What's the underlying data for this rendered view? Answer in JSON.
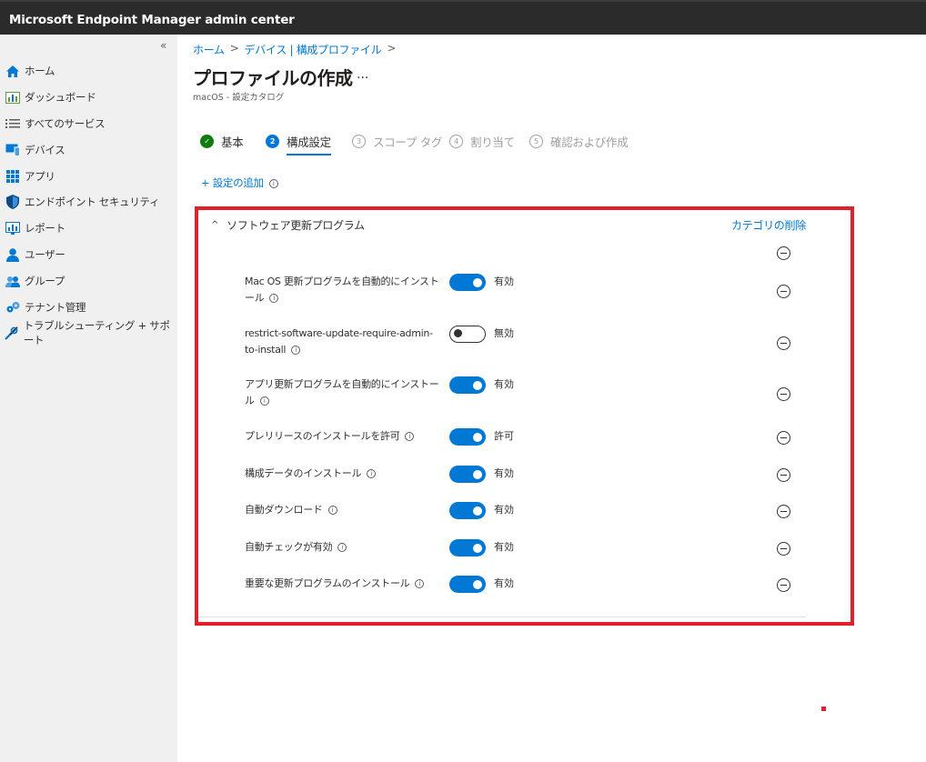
{
  "app": {
    "title": "Microsoft Endpoint Manager admin center"
  },
  "sidebar": {
    "collapse_glyph": "«",
    "items": [
      {
        "label": "ホーム",
        "icon": "home-icon",
        "color": "#0078d4"
      },
      {
        "label": "ダッシュボード",
        "icon": "dashboard-icon",
        "color": "#5c9d3c"
      },
      {
        "label": "すべてのサービス",
        "icon": "list-icon",
        "color": "#605e5c"
      },
      {
        "label": "デバイス",
        "icon": "device-icon",
        "color": "#0078d4"
      },
      {
        "label": "アプリ",
        "icon": "apps-grid-icon",
        "color": "#0078d4"
      },
      {
        "label": "エンドポイント セキュリティ",
        "icon": "shield-icon",
        "color": "#0f4a85"
      },
      {
        "label": "レポート",
        "icon": "report-icon",
        "color": "#0078d4"
      },
      {
        "label": "ユーザー",
        "icon": "user-icon",
        "color": "#0078d4"
      },
      {
        "label": "グループ",
        "icon": "group-icon",
        "color": "#0078d4"
      },
      {
        "label": "テナント管理",
        "icon": "tenant-gear-icon",
        "color": "#0078d4"
      },
      {
        "label": "トラブルシューティング + サポート",
        "icon": "wrench-icon",
        "color": "#0078d4"
      }
    ]
  },
  "breadcrumb": {
    "items": [
      "ホーム",
      "デバイス | 構成プロファイル"
    ],
    "separator": ">"
  },
  "page": {
    "title": "プロファイルの作成",
    "more": "...",
    "subtitle": "macOS - 設定カタログ"
  },
  "wizard": {
    "steps": [
      {
        "num": "✓",
        "label": "基本",
        "state": "done"
      },
      {
        "num": "2",
        "label": "構成設定",
        "state": "active"
      },
      {
        "num": "3",
        "label": "スコープ タグ",
        "state": "future"
      },
      {
        "num": "4",
        "label": "割り当て",
        "state": "future"
      },
      {
        "num": "5",
        "label": "確認および作成",
        "state": "future"
      }
    ]
  },
  "add_setting": {
    "label": "+ 設定の追加"
  },
  "category": {
    "chevron": "^",
    "name": "ソフトウェア更新プログラム",
    "delete_label": "カテゴリの削除",
    "settings": [
      {
        "label": "Mac OS 更新プログラムを自動的にインストール",
        "enabled": true,
        "state": "有効"
      },
      {
        "label": "restrict-software-update-require-admin-to-install",
        "enabled": false,
        "state": "無効"
      },
      {
        "label": "アプリ更新プログラムを自動的にインストール",
        "enabled": true,
        "state": "有効"
      },
      {
        "label": "プレリリースのインストールを許可",
        "enabled": true,
        "state": "許可"
      },
      {
        "label": "構成データのインストール",
        "enabled": true,
        "state": "有効"
      },
      {
        "label": "自動ダウンロード",
        "enabled": true,
        "state": "有効"
      },
      {
        "label": "自動チェックが有効",
        "enabled": true,
        "state": "有効"
      },
      {
        "label": "重要な更新プログラムのインストール",
        "enabled": true,
        "state": "有効"
      }
    ]
  },
  "colors": {
    "accent": "#0078d4",
    "highlight_frame": "#e3202a",
    "success": "#107c10"
  }
}
